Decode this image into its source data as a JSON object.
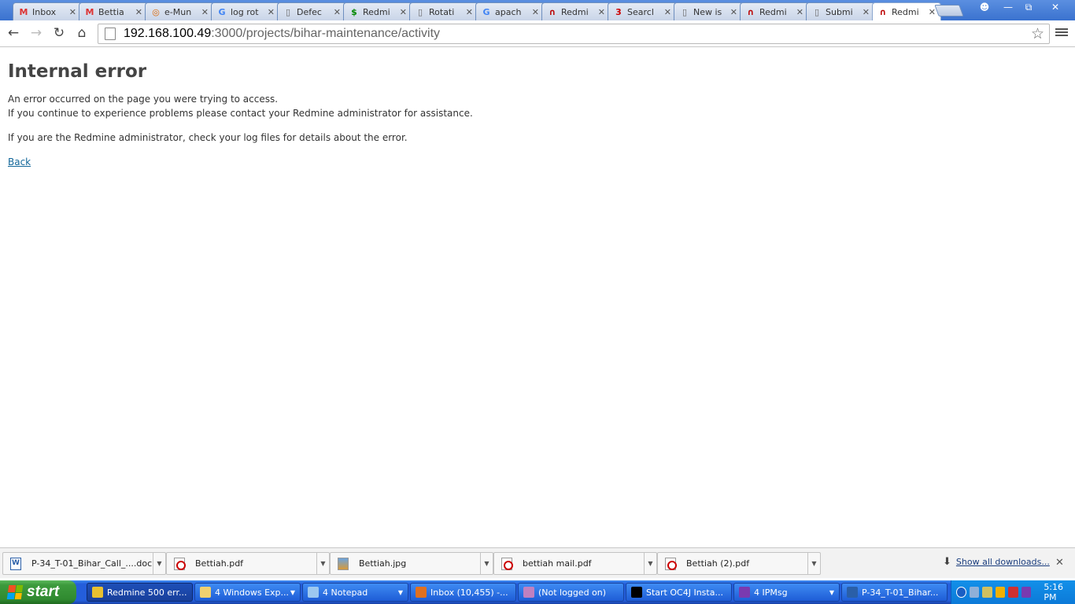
{
  "tabs": [
    {
      "label": "Inbox",
      "icon": "gmail-icon",
      "active": false
    },
    {
      "label": "Bettia",
      "icon": "gmail-icon",
      "active": false
    },
    {
      "label": "e-Mun",
      "icon": "app-icon",
      "active": false
    },
    {
      "label": "log rot",
      "icon": "google-icon",
      "active": false
    },
    {
      "label": "Defec",
      "icon": "page-icon",
      "active": false
    },
    {
      "label": "Redmi",
      "icon": "redmine-ruby-icon",
      "active": false
    },
    {
      "label": "Rotati",
      "icon": "page-icon",
      "active": false
    },
    {
      "label": "apach",
      "icon": "google-icon",
      "active": false
    },
    {
      "label": "Redmi",
      "icon": "redmine-icon",
      "active": false
    },
    {
      "label": "Searcl",
      "icon": "notification-3-icon",
      "active": false
    },
    {
      "label": "New is",
      "icon": "page-icon",
      "active": false
    },
    {
      "label": "Redmi",
      "icon": "redmine-icon",
      "active": false
    },
    {
      "label": "Submi",
      "icon": "page-icon",
      "active": false
    },
    {
      "label": "Redmi",
      "icon": "redmine-icon",
      "active": true
    }
  ],
  "address": {
    "host": "192.168.100.49",
    "rest": ":3000/projects/bihar-maintenance/activity"
  },
  "page": {
    "heading": "Internal error",
    "line1": "An error occurred on the page you were trying to access.",
    "line2": "If you continue to experience problems please contact your Redmine administrator for assistance.",
    "line3": "If you are the Redmine administrator, check your log files for details about the error.",
    "back_link": "Back"
  },
  "downloads": {
    "items": [
      {
        "name": "P-34_T-01_Bihar_Call_....doc",
        "type": "doc"
      },
      {
        "name": "Bettiah.pdf",
        "type": "pdf"
      },
      {
        "name": "Bettiah.jpg",
        "type": "jpg"
      },
      {
        "name": "bettiah mail.pdf",
        "type": "pdf"
      },
      {
        "name": "Bettiah (2).pdf",
        "type": "pdf"
      }
    ],
    "show_all": "Show all downloads..."
  },
  "taskbar": {
    "start_label": "start",
    "tasks": [
      {
        "label": "Redmine 500 err...",
        "icon": "chrome-icon",
        "active": true
      },
      {
        "label": "4 Windows Exp...",
        "icon": "folder-icon",
        "active": false,
        "group": true
      },
      {
        "label": "4 Notepad",
        "icon": "notepad-icon",
        "active": false,
        "group": true
      },
      {
        "label": "Inbox (10,455) -...",
        "icon": "firefox-icon",
        "active": false
      },
      {
        "label": "(Not logged on)",
        "icon": "network-icon",
        "active": false
      },
      {
        "label": "Start OC4J Insta...",
        "icon": "cmd-icon",
        "active": false
      },
      {
        "label": "4 IPMsg",
        "icon": "ipmsg-icon",
        "active": false,
        "group": true
      },
      {
        "label": "P-34_T-01_Bihar...",
        "icon": "word-icon",
        "active": false
      }
    ],
    "clock": "5:16 PM"
  },
  "colors": {
    "link": "#116699",
    "taskbar": "#245edb",
    "start": "#3c9a3c"
  }
}
